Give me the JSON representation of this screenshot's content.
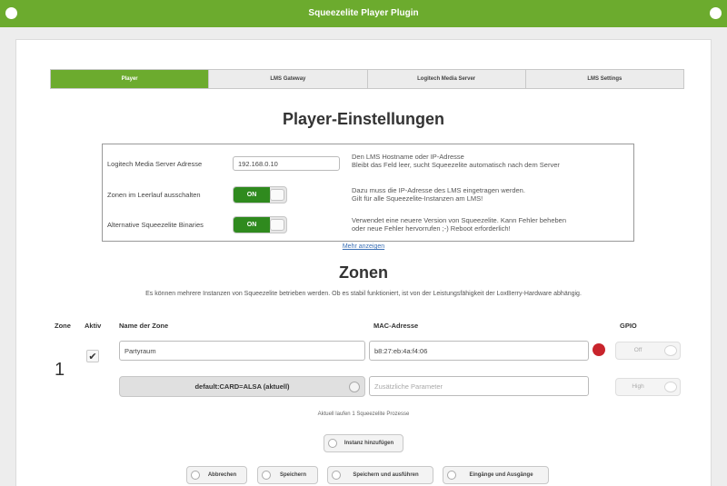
{
  "window": {
    "title": "Squeezelite Player Plugin"
  },
  "tabs": [
    "Player",
    "LMS Gateway",
    "Logitech Media Server",
    "LMS Settings"
  ],
  "player_settings": {
    "heading": "Player-Einstellungen",
    "rows": [
      {
        "label": "Logitech Media Server Adresse",
        "value": "192.168.0.10",
        "desc": [
          "Den LMS Hostname oder IP-Adresse",
          "Bleibt das Feld leer, sucht Squeezelite automatisch nach dem Server"
        ]
      },
      {
        "label": "Zonen im Leerlauf ausschalten",
        "toggle": "ON",
        "desc": [
          "Dazu muss die IP-Adresse des LMS eingetragen werden.",
          "Gilt für alle Squeezelite-Instanzen am LMS!"
        ]
      },
      {
        "label": "Alternative Squeezelite Binaries",
        "toggle": "ON",
        "desc": [
          "Verwendet eine neuere Version von Squeezelite. Kann Fehler beheben",
          "oder neue Fehler hervorrufen ;-) Reboot erforderlich!"
        ]
      }
    ],
    "more_link": "Mehr anzeigen"
  },
  "zones": {
    "heading": "Zonen",
    "info": "Es können mehrere Instanzen von Squeezelite betrieben werden. Ob es stabil funktioniert, ist von der Leistungsfähigkeit der LoxBerry-Hardware abhängig.",
    "columns": {
      "zone": "Zone",
      "active": "Aktiv",
      "name": "Name der Zone",
      "mac": "MAC-Adresse",
      "gpio": "GPIO"
    },
    "rows": [
      {
        "number": "1",
        "active_mark": "✔",
        "name": "Partyraum",
        "mac": "b8:27:eb:4a:f4:06",
        "gpio_toggle": "Off",
        "gpio_level": "High",
        "output": "default:CARD=ALSA (aktuell)",
        "params_placeholder": "Zusätzliche Parameter"
      }
    ],
    "status": "Aktuell laufen 1 Squeezelite Prozesse"
  },
  "buttons": {
    "add_instance": "Instanz hinzufügen",
    "cancel": "Abbrechen",
    "save": "Speichern",
    "save_apply": "Speichern und ausführen",
    "io": "Eingänge und Ausgänge"
  },
  "colors": {
    "accent": "#6cab2e",
    "toggle_on": "#2f8a1e",
    "error": "#c8242c",
    "link": "#3a6fb5"
  }
}
